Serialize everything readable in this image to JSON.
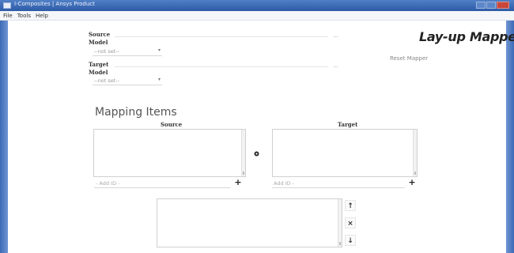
{
  "window": {
    "title": "I-Composites | Ansys Product",
    "app_icon": "app-window-icon"
  },
  "menu": {
    "items": [
      "File",
      "Tools",
      "Help"
    ]
  },
  "brand": {
    "title": "Lay-up Mapper"
  },
  "source": {
    "label_line1": "Source",
    "label_line2": "Model",
    "dropdown_value": "--not set--",
    "dots": "..."
  },
  "target": {
    "label_line1": "Target",
    "label_line2": "Model",
    "dropdown_value": "--not set--",
    "dots": "..."
  },
  "reset_link": "Reset Mapper",
  "mapping": {
    "title": "Mapping Items",
    "source_header": "Source",
    "target_header": "Target",
    "source_add_placeholder": "- Add ID -",
    "target_add_placeholder": "Add ID -",
    "add_label": "+"
  },
  "controls": {
    "up": "↑",
    "remove": "×",
    "down": "↓"
  }
}
